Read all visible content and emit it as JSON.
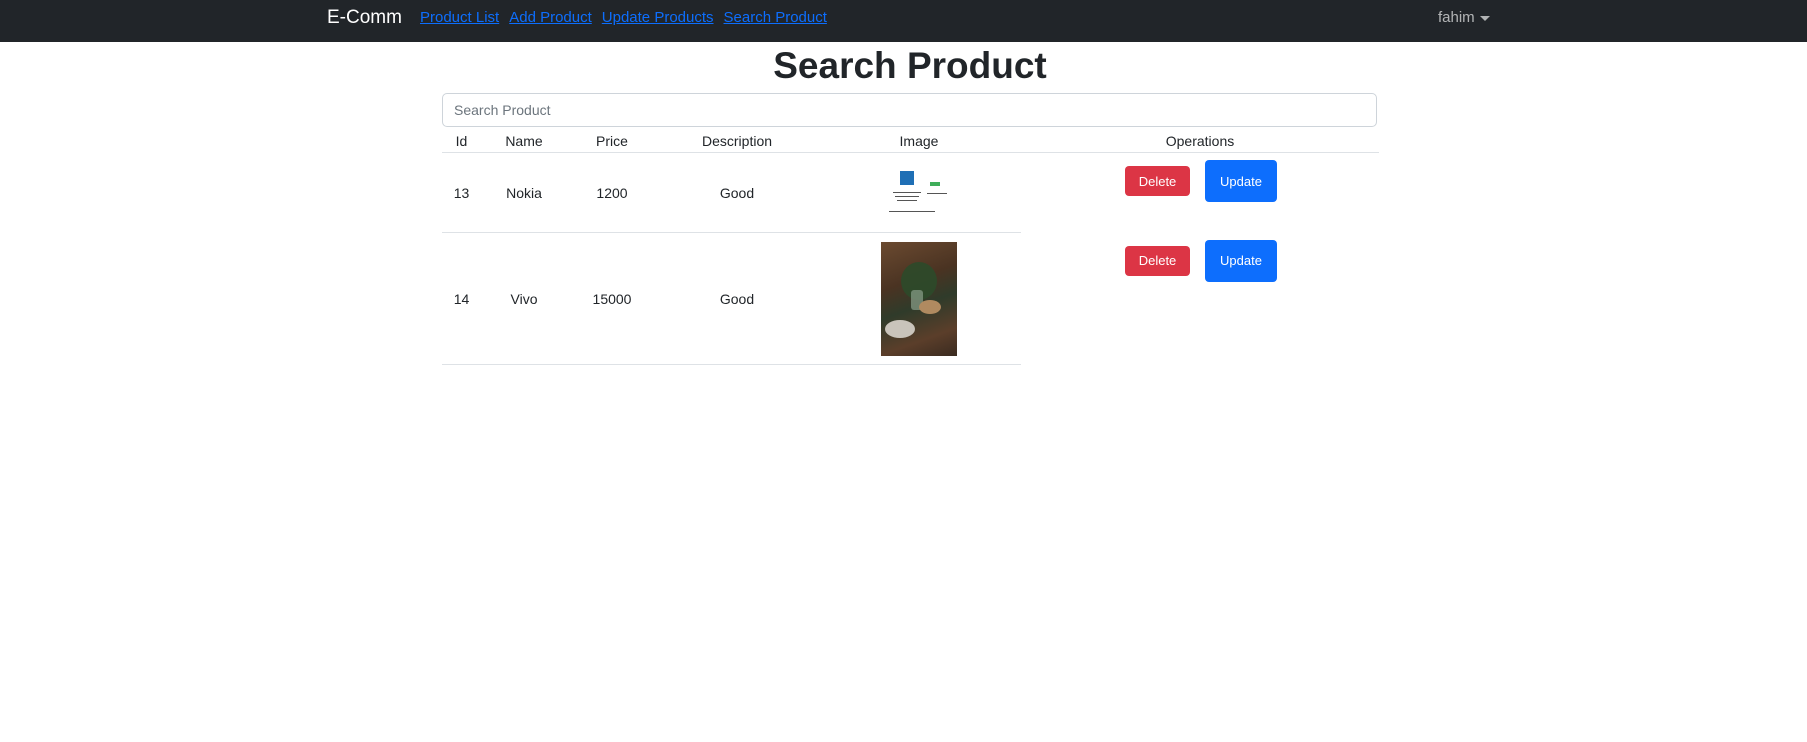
{
  "nav": {
    "brand": "E-Comm",
    "links": [
      "Product List",
      "Add Product",
      "Update Products",
      "Search Product"
    ],
    "user": "fahim"
  },
  "page": {
    "title": "Search Product",
    "search_placeholder": "Search Product"
  },
  "table": {
    "headers": [
      "Id",
      "Name",
      "Price",
      "Description",
      "Image",
      "Operations"
    ],
    "rows": [
      {
        "id": "13",
        "name": "Nokia",
        "price": "1200",
        "description": "Good",
        "image_icon": "product-image-thumbnail"
      },
      {
        "id": "14",
        "name": "Vivo",
        "price": "15000",
        "description": "Good",
        "image_icon": "product-image-thumbnail"
      }
    ],
    "delete_label": "Delete",
    "update_label": "Update"
  },
  "colors": {
    "navbar": "#212529",
    "link": "#0d6efd",
    "delete": "#dc3545",
    "update": "#0d6efd"
  }
}
